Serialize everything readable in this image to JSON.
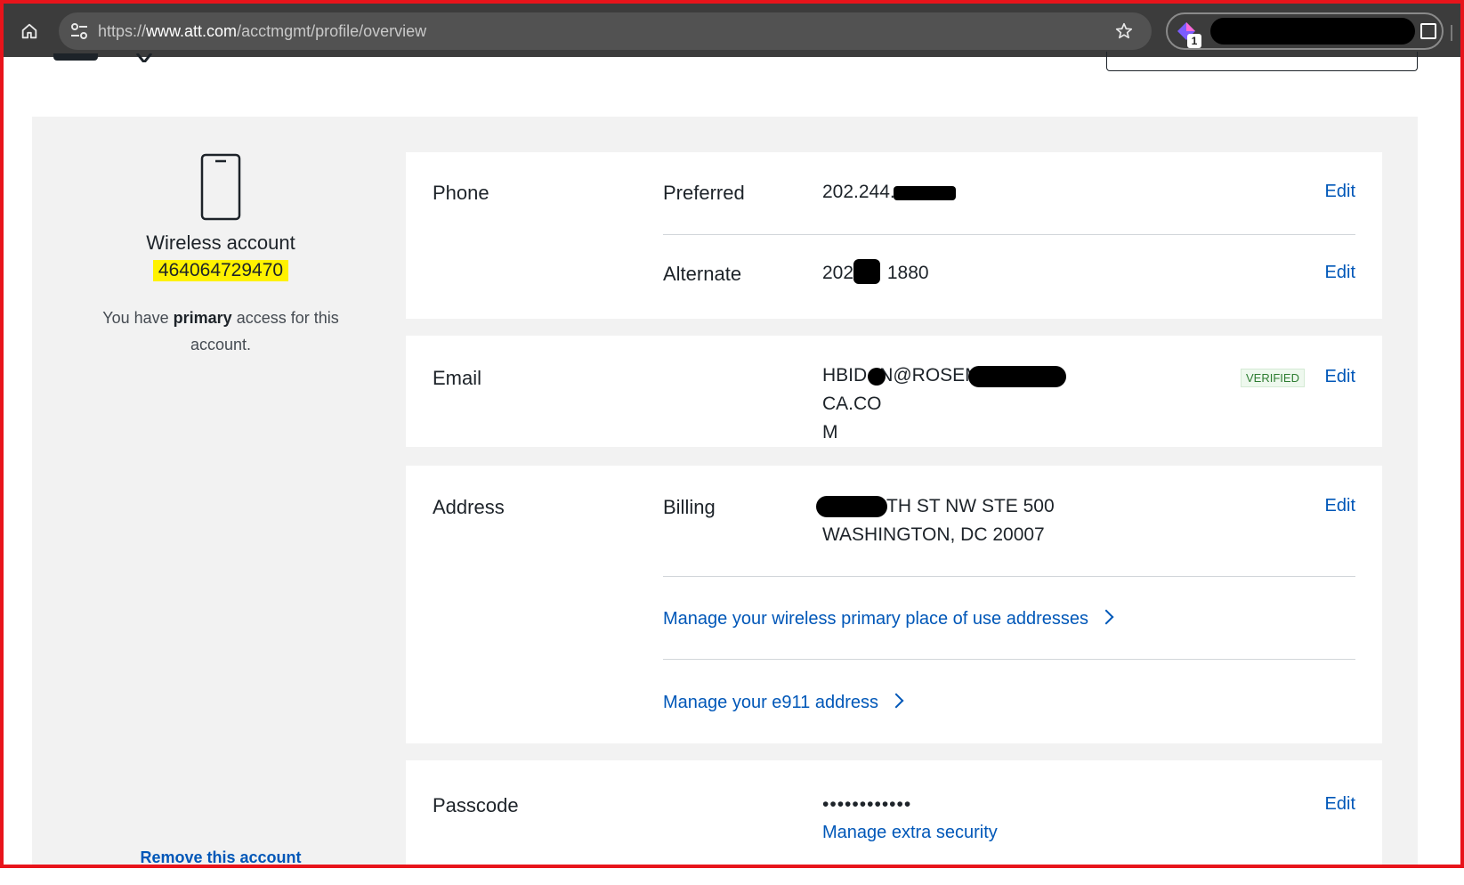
{
  "browser": {
    "url_prefix": "https://",
    "url_domain": "www.att.com",
    "url_path": "/acctmgmt/profile/overview",
    "extension_badge": "1"
  },
  "account": {
    "label": "Wireless account",
    "number": "464064729470",
    "access_prefix": "You have ",
    "access_bold": "primary",
    "access_suffix": " access for this account.",
    "remove_link": "Remove this account"
  },
  "phone": {
    "label": "Phone",
    "preferred_label": "Preferred",
    "preferred_value": "202.244.",
    "alternate_label": "Alternate",
    "alternate_value_start": "202.",
    "alternate_value_end": "1880",
    "edit": "Edit"
  },
  "email": {
    "label": "Email",
    "value_start": "HBID",
    "value_mid": "N@ROSEM",
    "value_end": "CA.CO",
    "value_wrap": "M",
    "verified": "VERIFIED",
    "edit": "Edit"
  },
  "address": {
    "label": "Address",
    "billing_label": "Billing",
    "line1": "TH ST NW STE 500",
    "line2": "WASHINGTON, DC 20007",
    "edit": "Edit",
    "link_place_of_use": "Manage your wireless primary place of use addresses",
    "link_e911": "Manage your e911 address"
  },
  "passcode": {
    "label": "Passcode",
    "value": "••••••••••••",
    "extra_security": "Manage extra security",
    "edit": "Edit"
  },
  "colors": {
    "link": "#0057b8",
    "highlight": "#fff200",
    "frame": "#e8141b",
    "browser_bar": "#3c3c3c"
  }
}
